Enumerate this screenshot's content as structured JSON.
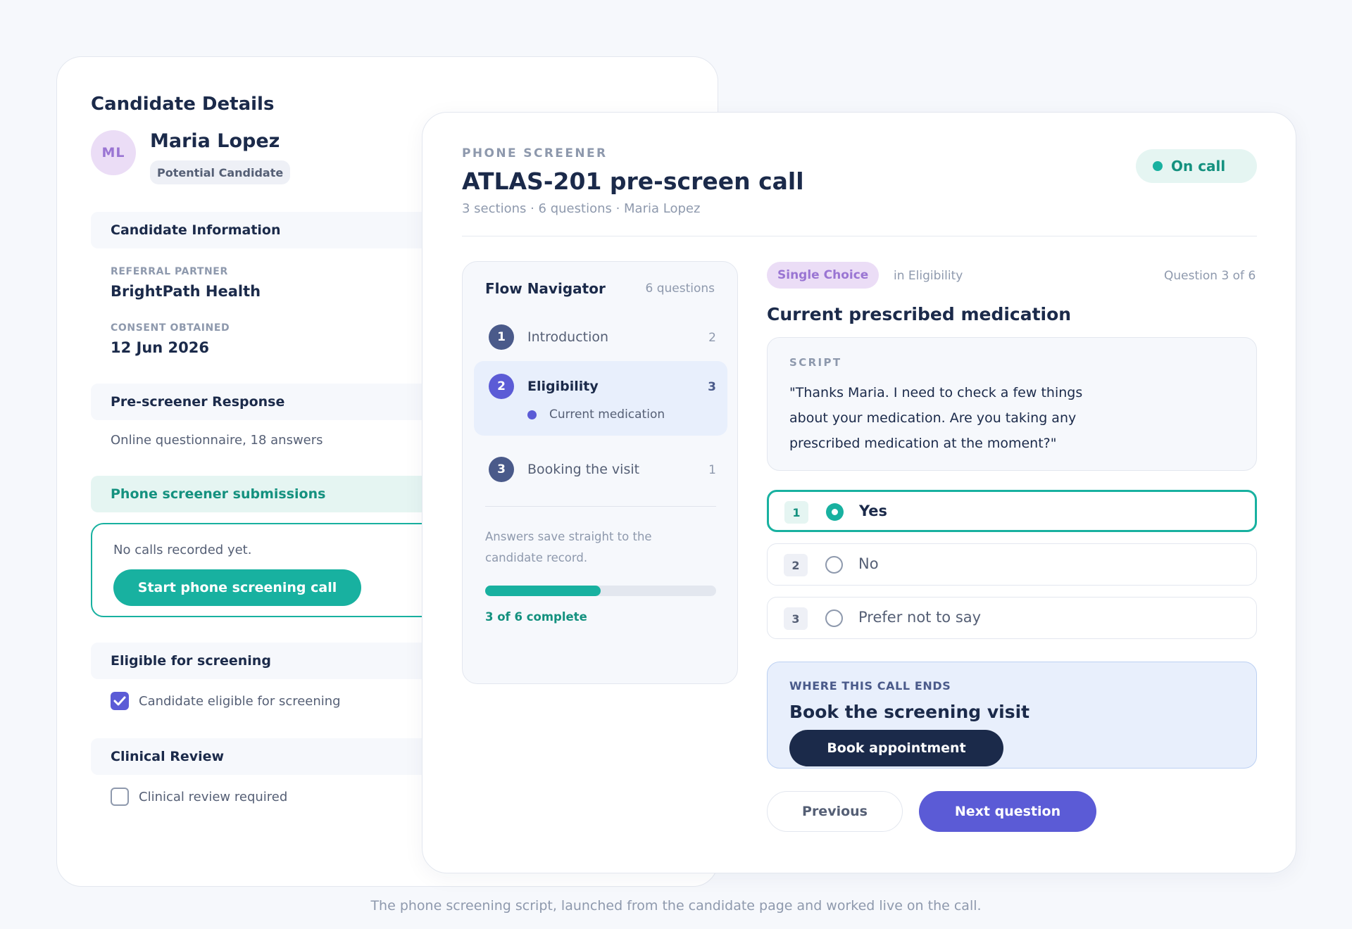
{
  "candidate_card": {
    "title": "Candidate Details",
    "avatar_initials": "ML",
    "name": "Maria Lopez",
    "status_badge": "Potential Candidate",
    "sections": {
      "candidate_information": "Candidate Information",
      "pre_screener_response": "Pre-screener Response",
      "phone_screener_submissions": "Phone screener submissions",
      "eligible_for_screening": "Eligible for screening",
      "clinical_review": "Clinical Review"
    },
    "fields": [
      {
        "label": "REFERRAL PARTNER",
        "value": "BrightPath Health"
      },
      {
        "label": "CONSENT OBTAINED",
        "value": "12 Jun 2026"
      }
    ],
    "pre_screener_summary": "Online questionnaire, 18 answers",
    "calls_empty_text": "No calls recorded yet.",
    "start_call_label": "Start phone screening call",
    "eligible_checkbox": {
      "label": "Candidate eligible for screening",
      "checked": true
    },
    "clinical_checkbox": {
      "label": "Clinical review required",
      "checked": false
    }
  },
  "modal": {
    "eyebrow": "PHONE SCREENER",
    "title": "ATLAS-201 pre-screen call",
    "subtitle": "3 sections · 6 questions · Maria Lopez",
    "status": "On call",
    "navigator": {
      "title": "Flow Navigator",
      "count": "6 questions",
      "sections": [
        {
          "number": "1",
          "label": "Introduction",
          "count": "2",
          "active": false
        },
        {
          "number": "2",
          "label": "Eligibility",
          "count": "3",
          "active": true,
          "current_question": "Current medication"
        },
        {
          "number": "3",
          "label": "Booking the visit",
          "count": "1",
          "active": false
        }
      ],
      "note": "Answers save straight to the candidate record.",
      "progress_fraction": 0.5,
      "progress_text": "3 of 6 complete"
    },
    "question": {
      "type": "Single Choice",
      "section": "in Eligibility",
      "progress": "Question 3 of 6",
      "title": "Current prescribed medication",
      "script_label": "SCRIPT",
      "script_text": "\"Thanks Maria. I need to check a few things about your medication. Are you taking any prescribed medication at the moment?\"",
      "options": [
        {
          "number": "1",
          "label": "Yes",
          "selected": true
        },
        {
          "number": "2",
          "label": "No",
          "selected": false
        },
        {
          "number": "3",
          "label": "Prefer not to say",
          "selected": false
        }
      ]
    },
    "call_end": {
      "label": "WHERE THIS CALL ENDS",
      "title": "Book the screening visit",
      "button": "Book appointment"
    },
    "previous_label": "Previous",
    "next_label": "Next question"
  },
  "caption": "The phone screening script, launched from the candidate page and worked live on the call.",
  "colors": {
    "teal": "#18b1a0",
    "indigo": "#5b5bd6",
    "navy": "#1b2a4a",
    "lavender": "#ebddf6"
  }
}
